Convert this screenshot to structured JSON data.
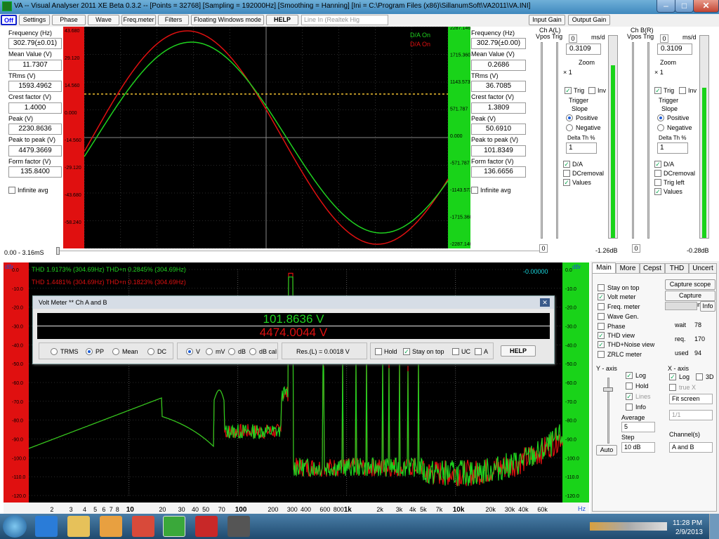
{
  "window": {
    "title": "VA -- Visual Analyser 2011 XE Beta 0.3.2 --  [Points = 32768]  [Sampling = 192000Hz]  [Smoothing = Hanning]  [Ini = C:\\Program Files (x86)\\SillanumSoft\\VA2011\\VA.INI]",
    "min": "–",
    "max": "□",
    "close": "✕"
  },
  "toolbar": {
    "off": "Off",
    "settings": "Settings",
    "phase": "Phase",
    "wave": "Wave",
    "freq_meter": "Freq.meter",
    "filters": "Filters",
    "floating": "Floating Windows mode",
    "help": "HELP",
    "input_device": "Line In (Realtek Hig",
    "input_gain": "Input Gain",
    "output_gain": "Output Gain"
  },
  "left_panel": {
    "freq_label": "Frequency (Hz)",
    "freq": "302.79(±0.01)",
    "mean_label": "Mean Value (V)",
    "mean": "11.7307",
    "trms_label": "TRms (V)",
    "trms": "1593.4962",
    "crest_label": "Crest factor (V)",
    "crest": "1.4000",
    "peak_label": "Peak (V)",
    "peak": "2230.8636",
    "p2p_label": "Peak to peak (V)",
    "p2p": "4479.3669",
    "form_label": "Form factor (V)",
    "form": "135.8400",
    "infinite": "Infinite avg",
    "timebase": "0.00 - 3.16mS"
  },
  "right_panel": {
    "freq": "302.79(±0.00)",
    "mean": "0.2686",
    "trms": "36.7085",
    "crest": "1.3809",
    "peak": "50.6910",
    "p2p": "101.8349",
    "form": "136.6656",
    "infinite": "Infinite avg"
  },
  "scope": {
    "legend_green": "D/A On",
    "legend_red": "D/A On",
    "left_ticks": [
      "43.680",
      "29.120",
      "14.560",
      "0.000",
      "-14.560",
      "-29.120",
      "-43.680",
      "-58.240"
    ],
    "right_ticks": [
      "2287.146",
      "1715.360",
      "1143.573",
      "571.787",
      "0.000",
      "-571.787",
      "-1143.573",
      "-1715.360",
      "-2287.146"
    ],
    "colors": {
      "green": "#1fd21f",
      "red": "#e01010",
      "left_bar": "#e01010",
      "right_bar": "#19d319"
    }
  },
  "cha": {
    "title": "Ch A(L)",
    "vpos": "Vpos",
    "trig": "Trig",
    "zero": "0",
    "msd": "ms/d",
    "ms": "0.3109",
    "zoom": "Zoom",
    "zoomx": "× 1",
    "trig_chk": "Trig",
    "inv": "Inv",
    "trigger": "Trigger",
    "slope": "Slope",
    "positive": "Positive",
    "negative": "Negative",
    "delta": "Delta Th %",
    "delta_val": "1",
    "da": "D/A",
    "dcrem": "DCremoval",
    "values": "Values",
    "bottom_zero": "0",
    "db": "-1.26dB"
  },
  "chb": {
    "title": "Ch B(R)",
    "vpos": "Vpos",
    "trig": "Trig",
    "zero": "0",
    "msd": "ms/d",
    "ms": "0.3109",
    "zoom": "Zoom",
    "zoomx": "× 1",
    "trig_chk": "Trig",
    "inv": "Inv",
    "trigger": "Trigger",
    "slope": "Slope",
    "positive": "Positive",
    "negative": "Negative",
    "delta": "Delta Th %",
    "delta_val": "1",
    "da": "D/A",
    "dcrem": "DCremoval",
    "trig_left": "Trig left",
    "values": "Values",
    "bottom_zero": "0",
    "db": "-0.28dB"
  },
  "spectrum": {
    "thd_green": "THD 1.9173% (304.69Hz) THD+n 0.2845% (304.69Hz)",
    "thd_red": "THD 1.4481% (304.69Hz) THD+n 0.1823% (304.69Hz)",
    "cursor": "-0.00000",
    "dbr": "dBr",
    "hz": "Hz",
    "y_ticks": [
      "0.0",
      "-10.0",
      "-20.0",
      "-30.0",
      "-40.0",
      "-50.0",
      "-60.0",
      "-70.0",
      "-80.0",
      "-90.0",
      "-100.0",
      "-110.0",
      "-120.0"
    ],
    "x_ticks": [
      "2",
      "3",
      "4",
      "5",
      "6",
      "7",
      "8",
      "10",
      "20",
      "30",
      "40",
      "50",
      "70",
      "100",
      "200",
      "300",
      "400",
      "600",
      "800",
      "1k",
      "2k",
      "3k",
      "4k",
      "5k",
      "7k",
      "10k",
      "20k",
      "30k",
      "40k",
      "60k"
    ]
  },
  "voltmeter": {
    "title": "Volt Meter ** Ch A and B",
    "close": "✕",
    "green": "101.8636 V",
    "red": "4474.0044 V",
    "trms": "TRMS",
    "pp": "PP",
    "mean": "Mean",
    "dc": "DC",
    "v": "V",
    "mv": "mV",
    "db": "dB",
    "dbcal": "dB cal",
    "res": "Res.(L) = 0.0018 V",
    "hold": "Hold",
    "stay": "Stay on top",
    "uc": "UC",
    "a": "A",
    "help": "HELP"
  },
  "side": {
    "tabs": [
      "Main",
      "More",
      "Cepst",
      "THD",
      "Uncert"
    ],
    "stay_on_top": "Stay on top",
    "volt_meter": "Volt meter",
    "freq_meter": "Freq. meter",
    "wave_gen": "Wave Gen.",
    "phase": "Phase",
    "thd_view": "THD view",
    "thdn_view": "THD+Noise view",
    "zrlc": "ZRLC meter",
    "capture_scope": "Capture scope",
    "capture_spectrum": "Capture spectrum",
    "info": "Info",
    "wait": "wait",
    "wait_val": "78",
    "req": "req.",
    "req_val": "170",
    "used": "used",
    "used_val": "94",
    "yaxis": "Y - axis",
    "log": "Log",
    "hold": "Hold",
    "lines": "Lines",
    "info2": "Info",
    "average": "Average",
    "average_val": "5",
    "step": "Step",
    "step_val": "10 dB",
    "auto": "Auto",
    "xaxis": "X - axis",
    "xlog": "Log",
    "x3d": "3D",
    "truex": "true X",
    "fit": "Fit screen",
    "ratio": "1/1",
    "channels": "Channel(s)",
    "channels_val": "A and B"
  },
  "taskbar": {
    "time": "11:28 PM",
    "date": "2/9/2013"
  }
}
